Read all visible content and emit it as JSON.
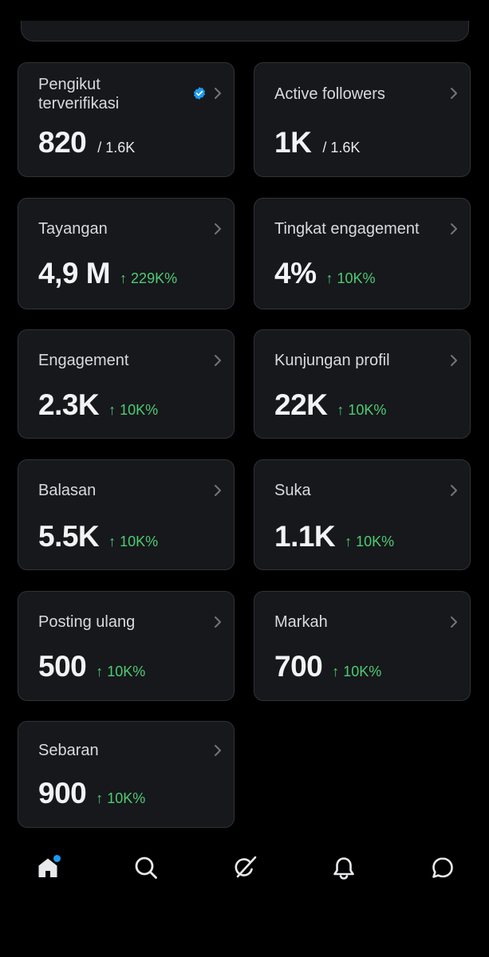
{
  "cards": [
    {
      "label": "Pengikut terverifikasi",
      "label_line1": "Pengikut",
      "label_line2": "terverifikasi",
      "value": "820",
      "sub": "/ 1.6K"
    },
    {
      "label": "Active followers",
      "value": "1K",
      "sub": "/ 1.6K"
    },
    {
      "label": "Tayangan",
      "value": "4,9 M",
      "delta": "↑ 229K%"
    },
    {
      "label": "Tingkat engagement",
      "value": "4%",
      "delta": "↑ 10K%"
    },
    {
      "label": "Engagement",
      "value": "2.3K",
      "delta": "↑ 10K%"
    },
    {
      "label": "Kunjungan profil",
      "value": "22K",
      "delta": "↑ 10K%"
    },
    {
      "label": "Balasan",
      "value": "5.5K",
      "delta": "↑ 10K%"
    },
    {
      "label": "Suka",
      "value": "1.1K",
      "delta": "↑ 10K%"
    },
    {
      "label": "Posting ulang",
      "value": "500",
      "delta": "↑ 10K%"
    },
    {
      "label": "Markah",
      "value": "700",
      "delta": "↑ 10K%"
    },
    {
      "label": "Sebaran",
      "value": "900",
      "delta": "↑ 10K%"
    }
  ],
  "nav": {
    "items": [
      {
        "icon": "home-icon",
        "active": true,
        "has_badge": true
      },
      {
        "icon": "search-icon",
        "active": false
      },
      {
        "icon": "grok-icon",
        "active": false
      },
      {
        "icon": "bell-icon",
        "active": false
      },
      {
        "icon": "messages-icon",
        "active": false
      }
    ]
  },
  "colors": {
    "background": "#000000",
    "card": "#16181c",
    "border": "#2f3336",
    "positive": "#4ecb71",
    "accent": "#1d9bf0"
  }
}
